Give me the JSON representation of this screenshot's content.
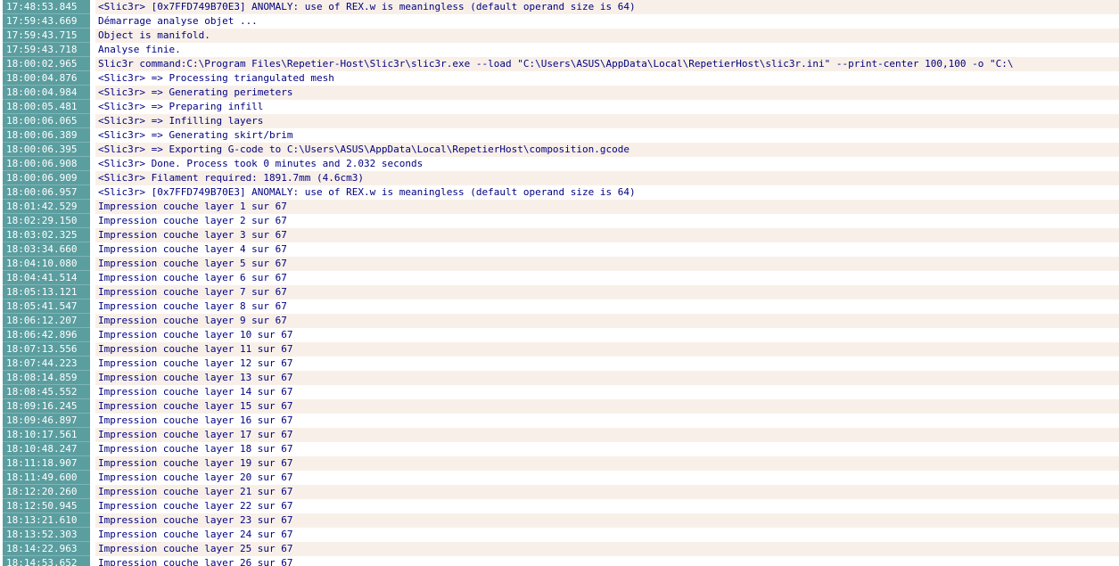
{
  "log": {
    "entries": [
      {
        "time": "17:48:53.845",
        "text": "<Slic3r> [0x7FFD749B70E3] ANOMALY: use of REX.w is meaningless (default operand size is 64)"
      },
      {
        "time": "17:59:43.669",
        "text": "Démarrage analyse objet ..."
      },
      {
        "time": "17:59:43.715",
        "text": "Object is manifold."
      },
      {
        "time": "17:59:43.718",
        "text": "Analyse finie."
      },
      {
        "time": "18:00:02.965",
        "text": "Slic3r command:C:\\Program Files\\Repetier-Host\\Slic3r\\slic3r.exe --load \"C:\\Users\\ASUS\\AppData\\Local\\RepetierHost\\slic3r.ini\" --print-center 100,100 -o \"C:\\"
      },
      {
        "time": "18:00:04.876",
        "text": "<Slic3r> => Processing triangulated mesh"
      },
      {
        "time": "18:00:04.984",
        "text": "<Slic3r> => Generating perimeters"
      },
      {
        "time": "18:00:05.481",
        "text": "<Slic3r> => Preparing infill"
      },
      {
        "time": "18:00:06.065",
        "text": "<Slic3r> => Infilling layers"
      },
      {
        "time": "18:00:06.389",
        "text": "<Slic3r> => Generating skirt/brim"
      },
      {
        "time": "18:00:06.395",
        "text": "<Slic3r> => Exporting G-code to C:\\Users\\ASUS\\AppData\\Local\\RepetierHost\\composition.gcode"
      },
      {
        "time": "18:00:06.908",
        "text": "<Slic3r> Done. Process took 0 minutes and 2.032 seconds"
      },
      {
        "time": "18:00:06.909",
        "text": "<Slic3r> Filament required: 1891.7mm (4.6cm3)"
      },
      {
        "time": "18:00:06.957",
        "text": "<Slic3r> [0x7FFD749B70E3] ANOMALY: use of REX.w is meaningless (default operand size is 64)"
      },
      {
        "time": "18:01:42.529",
        "text": "Impression couche layer 1 sur 67"
      },
      {
        "time": "18:02:29.150",
        "text": "Impression couche layer 2 sur 67"
      },
      {
        "time": "18:03:02.325",
        "text": "Impression couche layer 3 sur 67"
      },
      {
        "time": "18:03:34.660",
        "text": "Impression couche layer 4 sur 67"
      },
      {
        "time": "18:04:10.080",
        "text": "Impression couche layer 5 sur 67"
      },
      {
        "time": "18:04:41.514",
        "text": "Impression couche layer 6 sur 67"
      },
      {
        "time": "18:05:13.121",
        "text": "Impression couche layer 7 sur 67"
      },
      {
        "time": "18:05:41.547",
        "text": "Impression couche layer 8 sur 67"
      },
      {
        "time": "18:06:12.207",
        "text": "Impression couche layer 9 sur 67"
      },
      {
        "time": "18:06:42.896",
        "text": "Impression couche layer 10 sur 67"
      },
      {
        "time": "18:07:13.556",
        "text": "Impression couche layer 11 sur 67"
      },
      {
        "time": "18:07:44.223",
        "text": "Impression couche layer 12 sur 67"
      },
      {
        "time": "18:08:14.859",
        "text": "Impression couche layer 13 sur 67"
      },
      {
        "time": "18:08:45.552",
        "text": "Impression couche layer 14 sur 67"
      },
      {
        "time": "18:09:16.245",
        "text": "Impression couche layer 15 sur 67"
      },
      {
        "time": "18:09:46.897",
        "text": "Impression couche layer 16 sur 67"
      },
      {
        "time": "18:10:17.561",
        "text": "Impression couche layer 17 sur 67"
      },
      {
        "time": "18:10:48.247",
        "text": "Impression couche layer 18 sur 67"
      },
      {
        "time": "18:11:18.907",
        "text": "Impression couche layer 19 sur 67"
      },
      {
        "time": "18:11:49.600",
        "text": "Impression couche layer 20 sur 67"
      },
      {
        "time": "18:12:20.260",
        "text": "Impression couche layer 21 sur 67"
      },
      {
        "time": "18:12:50.945",
        "text": "Impression couche layer 22 sur 67"
      },
      {
        "time": "18:13:21.610",
        "text": "Impression couche layer 23 sur 67"
      },
      {
        "time": "18:13:52.303",
        "text": "Impression couche layer 24 sur 67"
      },
      {
        "time": "18:14:22.963",
        "text": "Impression couche layer 25 sur 67"
      },
      {
        "time": "18:14:53.652",
        "text": "Impression couche layer 26 sur 67"
      }
    ]
  },
  "colors": {
    "timestamp_bg": "#5b9ea0",
    "timestamp_text": "#ffffff",
    "message_text": "#000080",
    "row_alt_bg": "#f8f0e8"
  }
}
